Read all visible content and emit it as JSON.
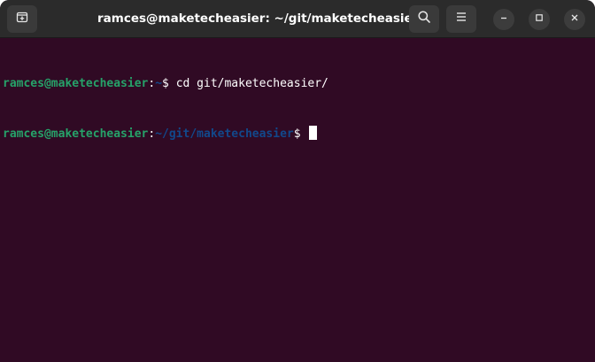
{
  "window": {
    "title": "ramces@maketecheasier: ~/git/maketecheasier"
  },
  "icons": {
    "new_tab": "new-tab-icon",
    "search": "search-icon",
    "menu": "hamburger-menu-icon",
    "minimize": "minimize-icon",
    "maximize": "maximize-icon",
    "close": "close-icon"
  },
  "colors": {
    "terminal_bg": "#300a24",
    "titlebar_bg": "#2b2b2b",
    "prompt_user_host": "#26a269",
    "prompt_path": "#12488b"
  },
  "terminal": {
    "lines": [
      {
        "user_host": "ramces@maketecheasier",
        "separator": ":",
        "path": "~",
        "prompt_symbol": "$ ",
        "command": "cd git/maketecheasier/"
      },
      {
        "user_host": "ramces@maketecheasier",
        "separator": ":",
        "path": "~/git/maketecheasier",
        "prompt_symbol": "$ ",
        "command": ""
      }
    ]
  }
}
